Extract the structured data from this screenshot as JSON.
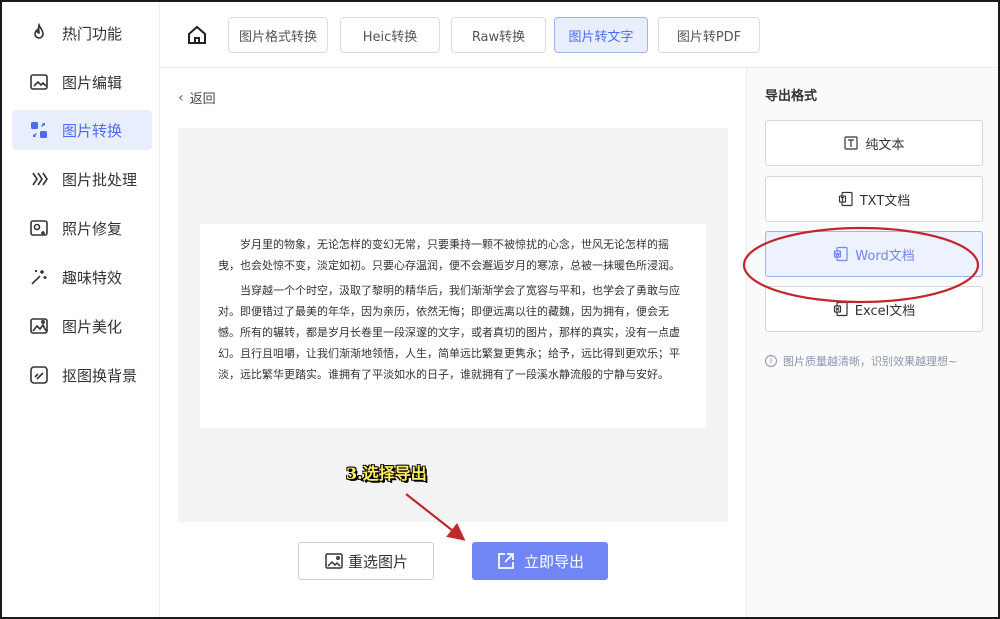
{
  "sidebar": {
    "items": [
      {
        "label": "热门功能",
        "icon": "flame-icon"
      },
      {
        "label": "图片编辑",
        "icon": "image-edit-icon"
      },
      {
        "label": "图片转换",
        "icon": "convert-icon",
        "active": true
      },
      {
        "label": "图片批处理",
        "icon": "batch-icon"
      },
      {
        "label": "照片修复",
        "icon": "repair-icon"
      },
      {
        "label": "趣味特效",
        "icon": "sparkle-icon"
      },
      {
        "label": "图片美化",
        "icon": "beautify-icon"
      },
      {
        "label": "抠图换背景",
        "icon": "cutout-icon"
      }
    ]
  },
  "topbar": {
    "tabs": [
      {
        "label": "图片格式转换"
      },
      {
        "label": "Heic转换"
      },
      {
        "label": "Raw转换"
      },
      {
        "label": "图片转文字",
        "active": true
      },
      {
        "label": "图片转PDF"
      }
    ]
  },
  "main": {
    "back_label": "返回",
    "document": {
      "paragraphs": [
        "岁月里的物象，无论怎样的变幻无常，只要秉持一颗不被惊扰的心念，世风无论怎样的摇曳，也会处惊不变，淡定如初。只要心存温润，便不会邂逅岁月的寒凉，总被一抹暖色所浸润。",
        "当穿越一个个时空，汲取了黎明的精华后，我们渐渐学会了宽容与平和，也学会了勇敢与应对。即便错过了最美的年华，因为亲历，依然无悔；即便远离以往的藏魏，因为拥有，便会无憾。所有的辗转，都是岁月长卷里一段深邃的文字，或者真切的图片，那样的真实，没有一点虚幻。且行且咀嚼，让我们渐渐地领悟，人生，简单远比繁复更隽永；给予，远比得到更欢乐；平淡，远比繁华更踏实。谁拥有了平淡如水的日子，谁就拥有了一段溪水静流般的宁静与安好。"
      ]
    },
    "annotation": "3.选择导出",
    "reselect_label": "重选图片",
    "export_label": "立即导出"
  },
  "right_panel": {
    "title": "导出格式",
    "formats": [
      {
        "label": "纯文本",
        "icon": "text-icon"
      },
      {
        "label": "TXT文档",
        "icon": "txt-icon"
      },
      {
        "label": "Word文档",
        "icon": "word-icon",
        "active": true
      },
      {
        "label": "Excel文档",
        "icon": "excel-icon"
      }
    ],
    "hint": "图片质量越清晰，识别效果越理想~"
  },
  "colors": {
    "accent": "#6f86f4",
    "active_bg": "#e9eefc",
    "annotation_red": "#c0282d",
    "annotation_yellow": "#ffef60"
  }
}
